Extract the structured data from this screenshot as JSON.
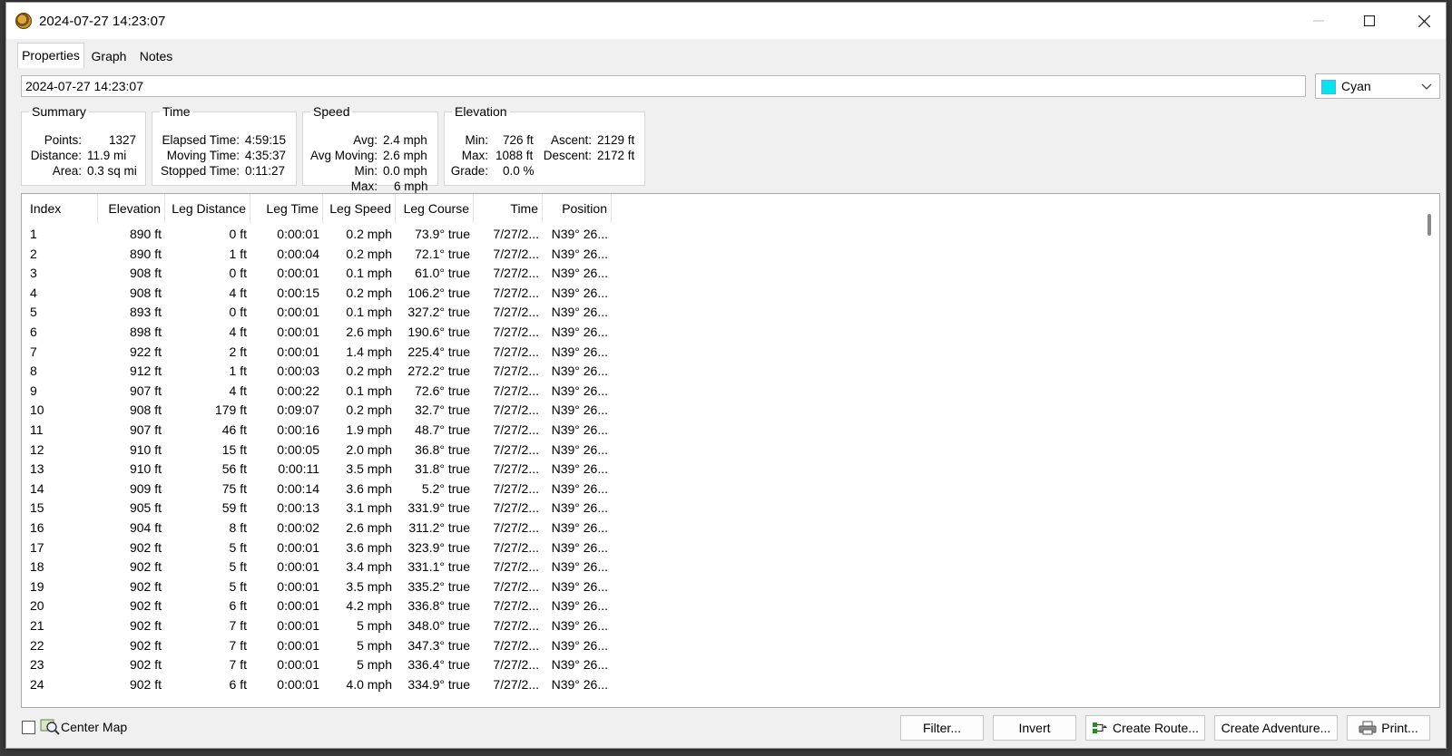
{
  "window": {
    "title": "2024-07-27 14:23:07"
  },
  "tabs": [
    {
      "label": "Properties",
      "active": true
    },
    {
      "label": "Graph",
      "active": false
    },
    {
      "label": "Notes",
      "active": false
    }
  ],
  "name_field": {
    "value": "2024-07-27 14:23:07"
  },
  "color_select": {
    "value": "Cyan",
    "swatch": "#00e5f0"
  },
  "summary": {
    "legend": "Summary",
    "points_label": "Points:",
    "points": "1327",
    "distance_label": "Distance:",
    "distance": "11.9 mi",
    "area_label": "Area:",
    "area": "0.3 sq mi"
  },
  "time": {
    "legend": "Time",
    "elapsed_label": "Elapsed Time:",
    "elapsed": "4:59:15",
    "moving_label": "Moving Time:",
    "moving": "4:35:37",
    "stopped_label": "Stopped Time:",
    "stopped": "0:11:27"
  },
  "speed": {
    "legend": "Speed",
    "avg_label": "Avg:",
    "avg": "2.4 mph",
    "avg_moving_label": "Avg Moving:",
    "avg_moving": "2.6 mph",
    "min_label": "Min:",
    "min": "0.0 mph",
    "max_label": "Max:",
    "max": "6 mph"
  },
  "elevation": {
    "legend": "Elevation",
    "min_label": "Min:",
    "min": "726 ft",
    "max_label": "Max:",
    "max": "1088 ft",
    "grade_label": "Grade:",
    "grade": "0.0 %",
    "ascent_label": "Ascent:",
    "ascent": "2129 ft",
    "descent_label": "Descent:",
    "descent": "2172 ft"
  },
  "table": {
    "columns": [
      "Index",
      "Elevation",
      "Leg Distance",
      "Leg Time",
      "Leg Speed",
      "Leg Course",
      "Time",
      "Position"
    ],
    "rows": [
      [
        "1",
        "890 ft",
        "0 ft",
        "0:00:01",
        "0.2 mph",
        "73.9° true",
        "7/27/2...",
        "N39° 26..."
      ],
      [
        "2",
        "890 ft",
        "1 ft",
        "0:00:04",
        "0.2 mph",
        "72.1° true",
        "7/27/2...",
        "N39° 26..."
      ],
      [
        "3",
        "908 ft",
        "0 ft",
        "0:00:01",
        "0.1 mph",
        "61.0° true",
        "7/27/2...",
        "N39° 26..."
      ],
      [
        "4",
        "908 ft",
        "4 ft",
        "0:00:15",
        "0.2 mph",
        "106.2° true",
        "7/27/2...",
        "N39° 26..."
      ],
      [
        "5",
        "893 ft",
        "0 ft",
        "0:00:01",
        "0.1 mph",
        "327.2° true",
        "7/27/2...",
        "N39° 26..."
      ],
      [
        "6",
        "898 ft",
        "4 ft",
        "0:00:01",
        "2.6 mph",
        "190.6° true",
        "7/27/2...",
        "N39° 26..."
      ],
      [
        "7",
        "922 ft",
        "2 ft",
        "0:00:01",
        "1.4 mph",
        "225.4° true",
        "7/27/2...",
        "N39° 26..."
      ],
      [
        "8",
        "912 ft",
        "1 ft",
        "0:00:03",
        "0.2 mph",
        "272.2° true",
        "7/27/2...",
        "N39° 26..."
      ],
      [
        "9",
        "907 ft",
        "4 ft",
        "0:00:22",
        "0.1 mph",
        "72.6° true",
        "7/27/2...",
        "N39° 26..."
      ],
      [
        "10",
        "908 ft",
        "179 ft",
        "0:09:07",
        "0.2 mph",
        "32.7° true",
        "7/27/2...",
        "N39° 26..."
      ],
      [
        "11",
        "907 ft",
        "46 ft",
        "0:00:16",
        "1.9 mph",
        "48.7° true",
        "7/27/2...",
        "N39° 26..."
      ],
      [
        "12",
        "910 ft",
        "15 ft",
        "0:00:05",
        "2.0 mph",
        "36.8° true",
        "7/27/2...",
        "N39° 26..."
      ],
      [
        "13",
        "910 ft",
        "56 ft",
        "0:00:11",
        "3.5 mph",
        "31.8° true",
        "7/27/2...",
        "N39° 26..."
      ],
      [
        "14",
        "909 ft",
        "75 ft",
        "0:00:14",
        "3.6 mph",
        "5.2° true",
        "7/27/2...",
        "N39° 26..."
      ],
      [
        "15",
        "905 ft",
        "59 ft",
        "0:00:13",
        "3.1 mph",
        "331.9° true",
        "7/27/2...",
        "N39° 26..."
      ],
      [
        "16",
        "904 ft",
        "8 ft",
        "0:00:02",
        "2.6 mph",
        "311.2° true",
        "7/27/2...",
        "N39° 26..."
      ],
      [
        "17",
        "902 ft",
        "5 ft",
        "0:00:01",
        "3.6 mph",
        "323.9° true",
        "7/27/2...",
        "N39° 26..."
      ],
      [
        "18",
        "902 ft",
        "5 ft",
        "0:00:01",
        "3.4 mph",
        "331.1° true",
        "7/27/2...",
        "N39° 26..."
      ],
      [
        "19",
        "902 ft",
        "5 ft",
        "0:00:01",
        "3.5 mph",
        "335.2° true",
        "7/27/2...",
        "N39° 26..."
      ],
      [
        "20",
        "902 ft",
        "6 ft",
        "0:00:01",
        "4.2 mph",
        "336.8° true",
        "7/27/2...",
        "N39° 26..."
      ],
      [
        "21",
        "902 ft",
        "7 ft",
        "0:00:01",
        "5 mph",
        "348.0° true",
        "7/27/2...",
        "N39° 26..."
      ],
      [
        "22",
        "902 ft",
        "7 ft",
        "0:00:01",
        "5 mph",
        "347.3° true",
        "7/27/2...",
        "N39° 26..."
      ],
      [
        "23",
        "902 ft",
        "7 ft",
        "0:00:01",
        "5 mph",
        "336.4° true",
        "7/27/2...",
        "N39° 26..."
      ],
      [
        "24",
        "902 ft",
        "6 ft",
        "0:00:01",
        "4.0 mph",
        "334.9° true",
        "7/27/2...",
        "N39° 26..."
      ]
    ]
  },
  "bottom": {
    "center_map_label": "Center Map",
    "center_map_checked": false,
    "filter_label": "Filter...",
    "invert_label": "Invert",
    "create_route_label": "Create Route...",
    "create_adventure_label": "Create Adventure...",
    "print_label": "Print..."
  }
}
